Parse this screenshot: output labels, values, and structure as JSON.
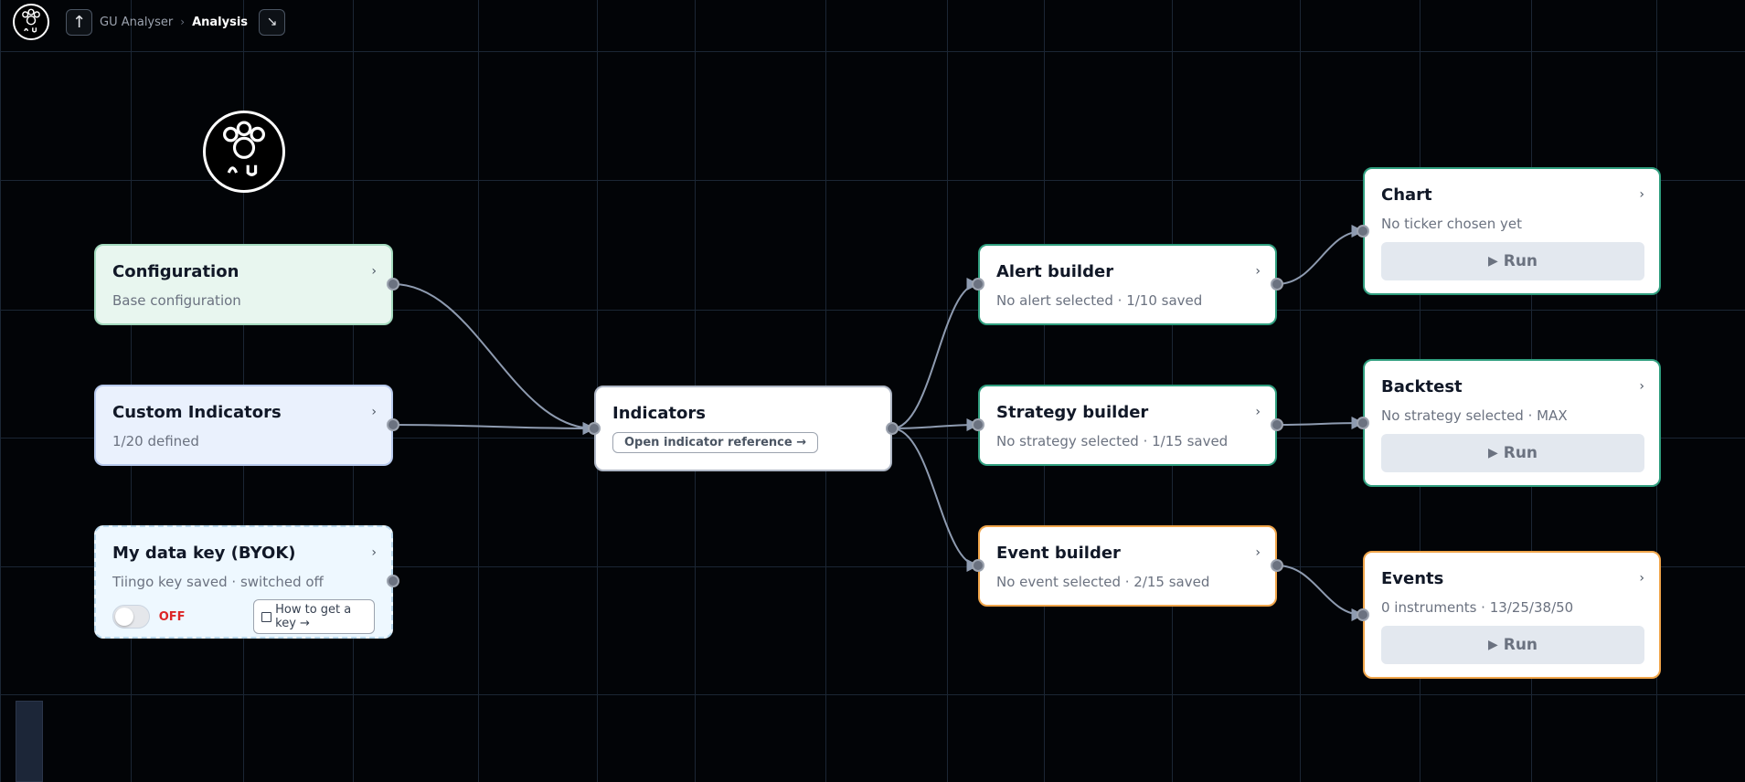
{
  "topbar": {
    "breadcrumb_parent": "GU Analyser",
    "breadcrumb_sep": "›",
    "breadcrumb_current": "Analysis",
    "up_icon": "↑",
    "collapse_icon": "↘"
  },
  "nodes": {
    "configuration": {
      "title": "Configuration",
      "subtitle": "Base configuration"
    },
    "custom_indicators": {
      "title": "Custom Indicators",
      "subtitle": "1/20 defined"
    },
    "byok": {
      "title": "My data key (BYOK)",
      "subtitle": "Tiingo key saved · switched off",
      "toggle_state": "OFF",
      "help_label": "How to get a key →"
    },
    "indicators": {
      "title": "Indicators",
      "ref_label": "Open indicator reference →"
    },
    "alert_builder": {
      "title": "Alert builder",
      "subtitle": "No alert selected · 1/10 saved"
    },
    "strategy_builder": {
      "title": "Strategy builder",
      "subtitle": "No strategy selected · 1/15 saved"
    },
    "event_builder": {
      "title": "Event builder",
      "subtitle": "No event selected · 2/15 saved"
    },
    "chart": {
      "title": "Chart",
      "subtitle": "No ticker chosen yet",
      "run_label": "Run"
    },
    "backtest": {
      "title": "Backtest",
      "subtitle": "No strategy selected · MAX",
      "run_label": "Run"
    },
    "events": {
      "title": "Events",
      "subtitle": "0 instruments · 13/25/38/50",
      "run_label": "Run"
    }
  },
  "colors": {
    "background": "#020407",
    "grid": "#1b2634",
    "edge": "#8e9bb0",
    "green_border": "#2f9e7e",
    "orange_border": "#f0a54a",
    "off_red": "#dc2626"
  },
  "icons": {
    "chevron": "›",
    "run": "▶"
  }
}
